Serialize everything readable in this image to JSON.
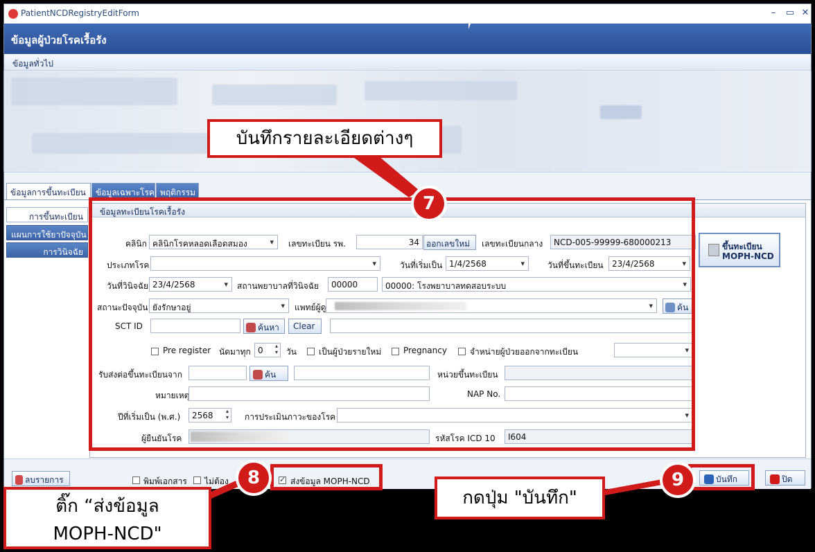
{
  "window": {
    "title": "PatientNCDRegistryEditForm",
    "header": "ข้อมูลผู้ป่วยโรคเรื้อรัง",
    "subbar": "ข้อมูลทั่วไป",
    "minimize": "–",
    "maximize": "▭",
    "close": "✕"
  },
  "tabs": [
    "ข้อมูลการขึ้นทะเบียน",
    "ข้อมูลเฉพาะโรค",
    "พฤติกรรม"
  ],
  "sidenav": [
    "การขึ้นทะเบียน",
    "แผนการใช้ยาปัจจุบัน",
    "การวินิจฉัย"
  ],
  "group_title": "ข้อมูลทะเบียนโรคเรื้อรัง",
  "form": {
    "clinic_label": "คลินิก",
    "clinic_value": "คลินิกโรคหลอดเลือดสมอง",
    "hn_label": "เลขทะเบียน รพ.",
    "hn_value": "34",
    "new_number_button": "ออกเลขใหม่",
    "central_no_label": "เลขทะเบียนกลาง",
    "central_no_value": "NCD-005-99999-680000213",
    "register_button_line1": "ขึ้นทะเบียน",
    "register_button_line2": "MOPH-NCD",
    "disease_type_label": "ประเภทโรค",
    "disease_type_value": "",
    "start_date_label": "วันที่เริ่มเป็น",
    "start_date_value": "1/4/2568",
    "register_date_label": "วันที่ขึ้นทะเบียน",
    "register_date_value": "23/4/2568",
    "diag_date_label": "วันที่วินิจฉัย",
    "diag_date_value": "23/4/2568",
    "diag_hosp_label": "สถานพยาบาลที่วินิจฉัย",
    "diag_hosp_code": "00000",
    "diag_hosp_name": "00000: โรงพยาบาลทดสอบระบบ",
    "status_label": "สถานะปัจจุบัน",
    "status_value": "ยังรักษาอยู่",
    "doctor_label": "แพทย์ผู้ดูแล",
    "doctor_search_button": "ค้น",
    "sct_label": "SCT ID",
    "sct_search_button": "ค้นหา",
    "clear_button": "Clear",
    "pre_register_label": "Pre register",
    "appoint_label": "นัดมาทุก",
    "appoint_value": "0",
    "appoint_unit": "วัน",
    "new_patient_label": "เป็นผู้ป่วยรายใหม่",
    "pregnancy_label": "Pregnancy",
    "discharge_label": "จำหน่ายผู้ป่วยออกจากทะเบียน",
    "referral_label": "รับส่งต่อขึ้นทะเบียนจาก",
    "referral_search_button": "ค้น",
    "register_unit_label": "หน่วยขึ้นทะเบียน",
    "note_label": "หมายเหตุ",
    "nap_label": "NAP No.",
    "start_year_label": "ปีที่เริ่มเป็น (พ.ศ.)",
    "start_year_value": "2568",
    "assessment_label": "การประเมินภาวะของโรค",
    "confirmer_label": "ผู้ยืนยันโรค",
    "icd_label": "รหัสโรค ICD 10",
    "icd_value": "I604"
  },
  "footer": {
    "delete_button": "ลบรายการ",
    "print_label": "พิมพ์เอกสาร",
    "no_need_label": "ไม่ต้อง",
    "send_moph_label": "ส่งข้อมูล MOPH-NCD",
    "save_button": "บันทึก",
    "close_button": "ปิด"
  },
  "annotations": {
    "callout_7": "บันทึกรายละเอียดต่างๆ",
    "badge_7": "7",
    "badge_8": "8",
    "badge_9": "9",
    "callout_8_line1": "ติ๊ก “ส่งข้อมูล",
    "callout_8_line2": "MOPH-NCD\"",
    "callout_9": "กดปุ่ม \"บันทึก\""
  },
  "colors": {
    "accent_red": "#d11a1a",
    "header_blue": "#2b4f95"
  }
}
